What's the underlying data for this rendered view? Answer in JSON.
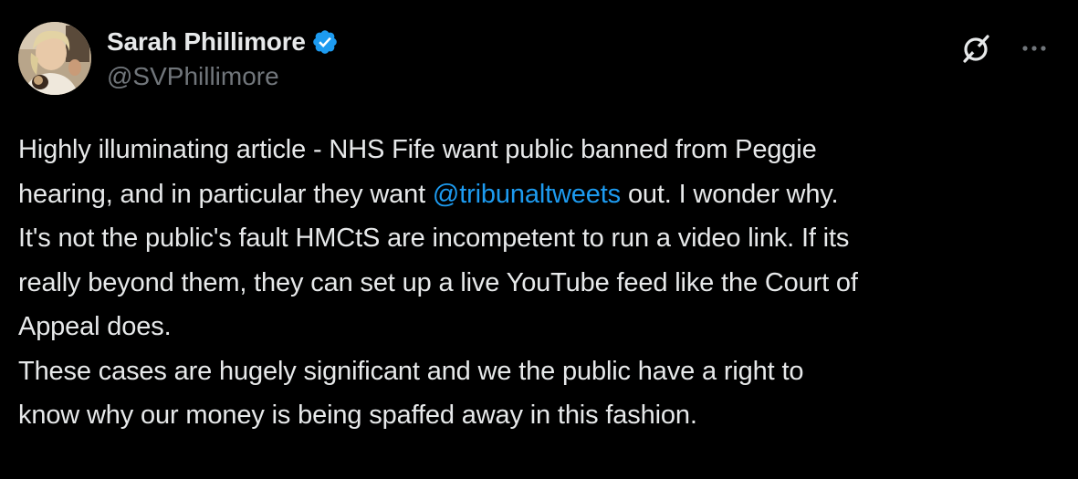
{
  "author": {
    "display_name": "Sarah Phillimore",
    "handle": "@SVPhillimore",
    "verified": true
  },
  "tweet": {
    "lines": [
      {
        "before": "Highly illuminating article - NHS Fife want public banned from Peggie",
        "mention": "",
        "after": ""
      },
      {
        "before": "hearing, and in particular they want ",
        "mention": "@tribunaltweets",
        "after": " out. I wonder why."
      },
      {
        "before": "It's not the public's fault HMCtS are incompetent to run a video link.  If its",
        "mention": "",
        "after": ""
      },
      {
        "before": "really beyond them, they can set up a live YouTube feed like the Court of",
        "mention": "",
        "after": ""
      },
      {
        "before": "Appeal does.",
        "mention": "",
        "after": ""
      },
      {
        "before": "These cases are hugely significant and we the public have a right to",
        "mention": "",
        "after": ""
      },
      {
        "before": "know why our money is being spaffed away in this fashion.",
        "mention": "",
        "after": ""
      }
    ]
  },
  "icons": {
    "verified": "verified-badge-icon",
    "grok": "grok-slash-icon",
    "more": "more-dots-icon"
  },
  "colors": {
    "background": "#000000",
    "text": "#e7e9ea",
    "secondary": "#71767b",
    "accent": "#1d9bf0"
  }
}
